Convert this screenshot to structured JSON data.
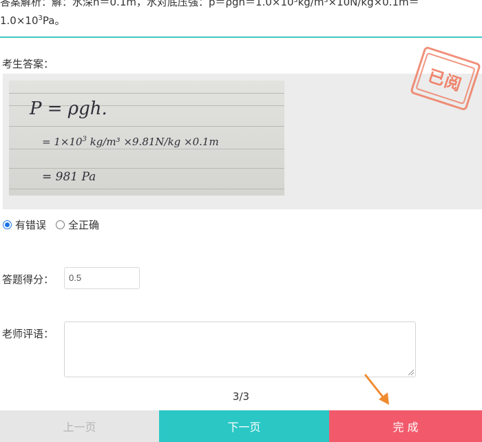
{
  "analysis": {
    "line1": "答案解析：解：水深h＝0.1m，水对底压强：p＝ρgh＝1.0×10³kg/m³×10N/kg×0.1m＝",
    "line2_prefix": "1.0×10",
    "line2_sup": "3",
    "line2_suffix": "Pa。"
  },
  "answer": {
    "label": "考生答案：",
    "handwriting": {
      "line1": "P = ρgh.",
      "line2_prefix": "= 1×10",
      "line2_sup": "3",
      "line2_suffix": " kg/m³  ×9.81N/kg  ×0.1m",
      "line3": "= 981 Pa"
    },
    "stamp_text": "已阅"
  },
  "judgement": {
    "options": [
      {
        "label": "有错误",
        "checked": true
      },
      {
        "label": "全正确",
        "checked": false
      }
    ]
  },
  "score": {
    "label": "答题得分：",
    "value": "0.5"
  },
  "comment": {
    "label": "老师评语：",
    "value": ""
  },
  "pager": {
    "text": "3/3"
  },
  "footer": {
    "prev_label": "上一页",
    "next_label": "下一页",
    "done_label": "完 成"
  },
  "colors": {
    "accent": "#2bc7c5",
    "divider": "#3fc6c2",
    "done": "#f25a6c",
    "stamp": "#ee7c62",
    "arrow": "#f08a2e"
  }
}
